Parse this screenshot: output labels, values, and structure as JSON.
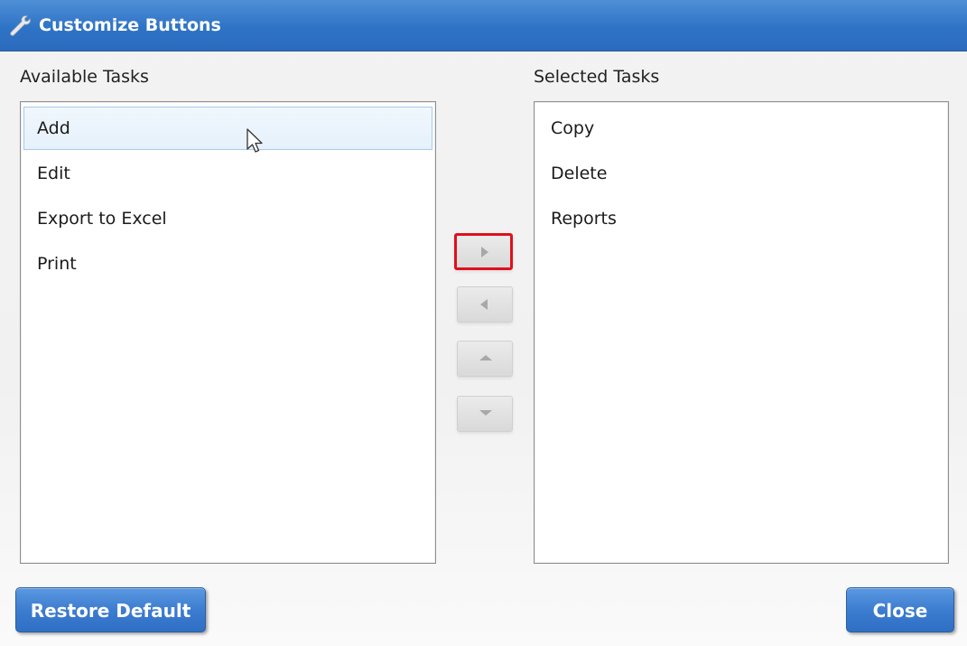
{
  "window": {
    "title": "Customize Buttons",
    "icon": "wrench-icon"
  },
  "available": {
    "label": "Available Tasks",
    "items": [
      {
        "label": "Add",
        "selected": true
      },
      {
        "label": "Edit",
        "selected": false
      },
      {
        "label": "Export to Excel",
        "selected": false
      },
      {
        "label": "Print",
        "selected": false
      }
    ]
  },
  "selected": {
    "label": "Selected Tasks",
    "items": [
      {
        "label": "Copy"
      },
      {
        "label": "Delete"
      },
      {
        "label": "Reports"
      }
    ]
  },
  "move_buttons": {
    "icons": [
      "triangle-right-icon",
      "triangle-left-icon",
      "triangle-up-icon",
      "triangle-down-icon"
    ],
    "highlight_color": "#e0101d"
  },
  "footer": {
    "restore_label": "Restore Default",
    "close_label": "Close"
  },
  "colors": {
    "title_bar": "#2f73c6",
    "button_blue": "#3d7dd0",
    "selection_bg": "#e6f1fb",
    "selection_border": "#a7c9ec"
  }
}
